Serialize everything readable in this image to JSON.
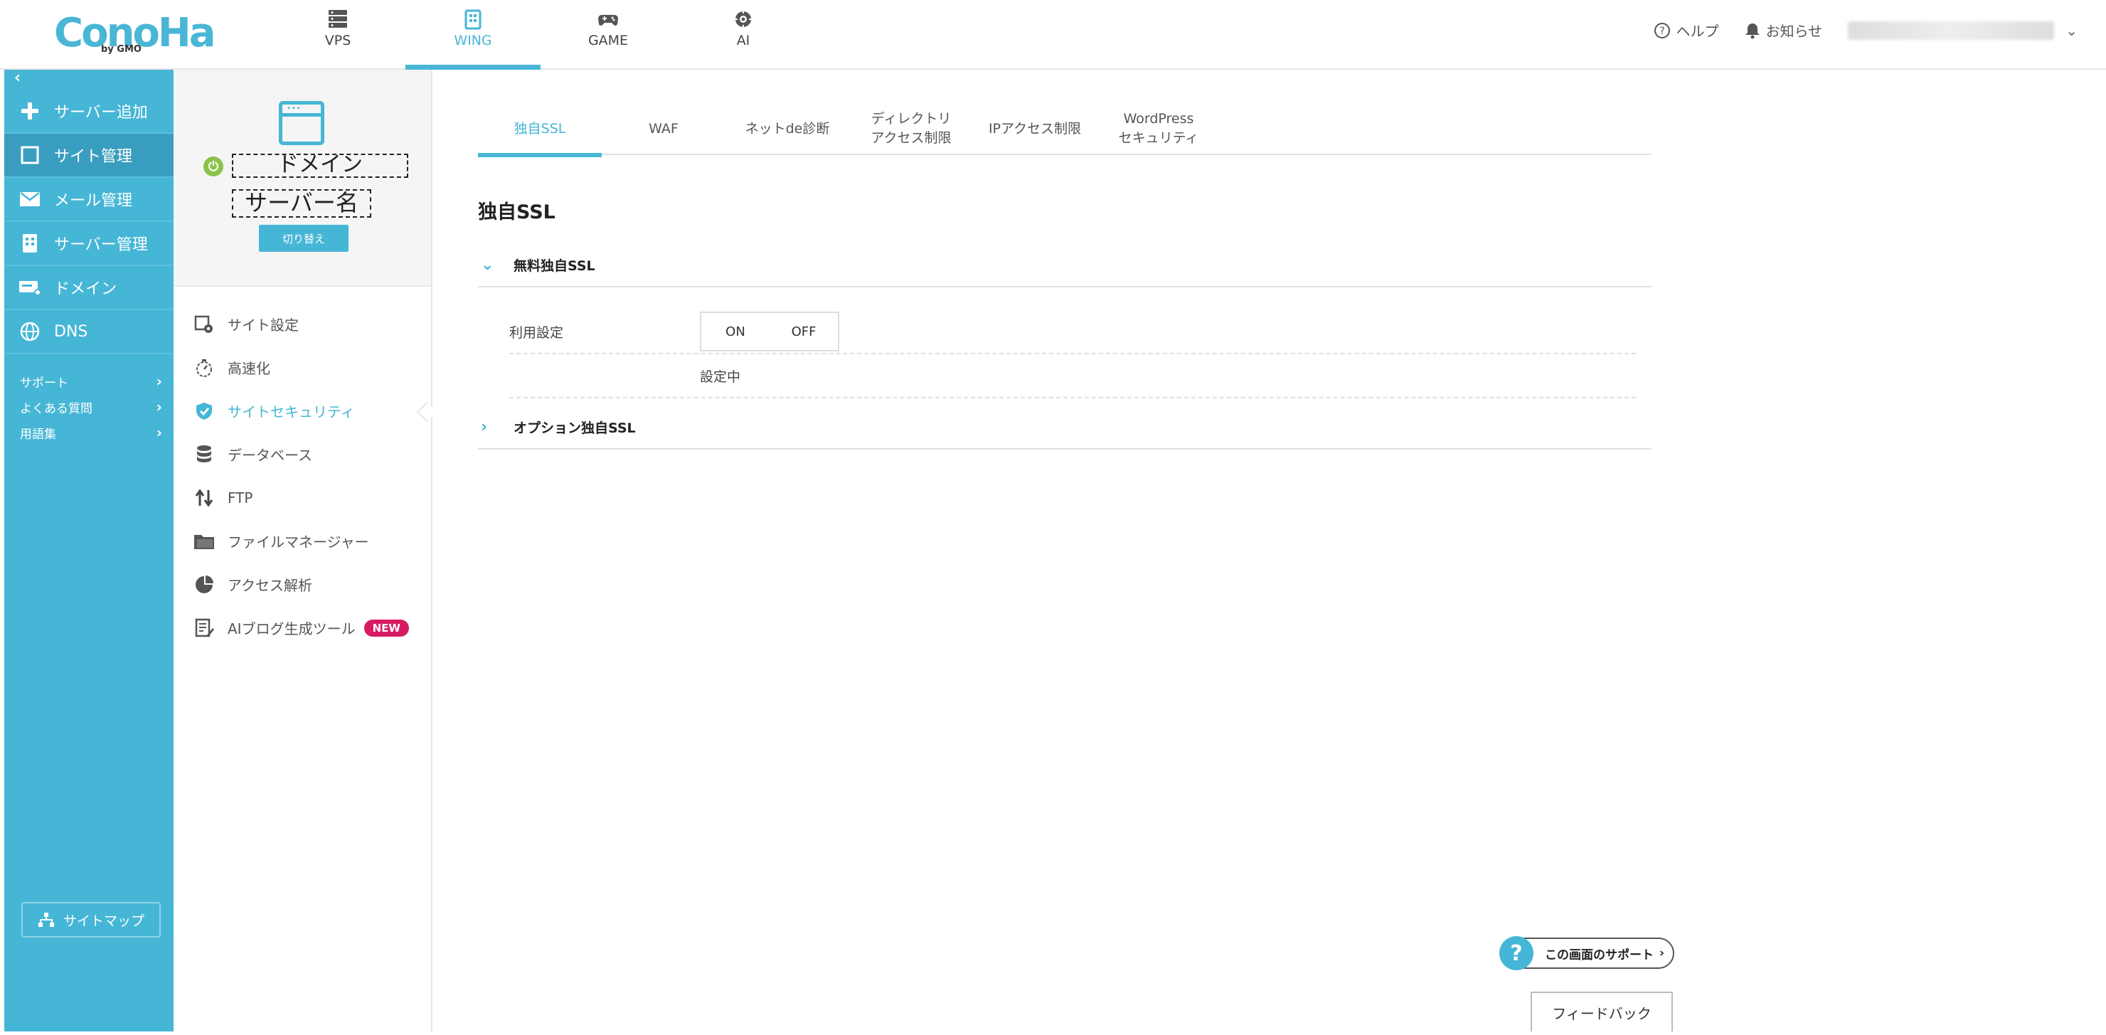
{
  "brand": {
    "logo_text": "ConoHa",
    "logo_sub": "by GMO",
    "accent_color": "#46b6d6"
  },
  "topnav": [
    {
      "id": "vps",
      "label": "VPS",
      "icon": "server-stack-icon"
    },
    {
      "id": "wing",
      "label": "WING",
      "icon": "building-icon",
      "active": true
    },
    {
      "id": "game",
      "label": "GAME",
      "icon": "gamepad-icon"
    },
    {
      "id": "ai",
      "label": "AI",
      "icon": "ai-chip-icon"
    }
  ],
  "topright": {
    "help": "ヘルプ",
    "notices": "お知らせ"
  },
  "sidebar": {
    "items": [
      {
        "label": "サーバー追加",
        "icon": "plus-icon"
      },
      {
        "label": "サイト管理",
        "icon": "window-icon",
        "active": true
      },
      {
        "label": "メール管理",
        "icon": "envelope-icon"
      },
      {
        "label": "サーバー管理",
        "icon": "server-icon"
      },
      {
        "label": "ドメイン",
        "icon": "domain-card-icon"
      },
      {
        "label": "DNS",
        "icon": "globe-icon"
      }
    ],
    "links": [
      {
        "label": "サポート"
      },
      {
        "label": "よくある質問"
      },
      {
        "label": "用語集"
      }
    ],
    "sitemap": "サイトマップ"
  },
  "subpanel": {
    "domain": "ドメイン",
    "server": "サーバー名",
    "switch_label": "切り替え",
    "menu": [
      {
        "label": "サイト設定",
        "icon": "site-settings-icon"
      },
      {
        "label": "高速化",
        "icon": "stopwatch-icon"
      },
      {
        "label": "サイトセキュリティ",
        "icon": "shield-check-icon",
        "active": true
      },
      {
        "label": "データベース",
        "icon": "database-icon"
      },
      {
        "label": "FTP",
        "icon": "transfer-arrows-icon"
      },
      {
        "label": "ファイルマネージャー",
        "icon": "folder-icon"
      },
      {
        "label": "アクセス解析",
        "icon": "pie-chart-icon"
      },
      {
        "label": "AIブログ生成ツール",
        "icon": "document-edit-icon",
        "badge": "NEW"
      }
    ]
  },
  "tabs": [
    {
      "label1": "独自SSL",
      "label2": "",
      "active": true
    },
    {
      "label1": "WAF",
      "label2": ""
    },
    {
      "label1": "ネットde診断",
      "label2": ""
    },
    {
      "label1": "ディレクトリ",
      "label2": "アクセス制限"
    },
    {
      "label1": "IPアクセス制限",
      "label2": ""
    },
    {
      "label1": "WordPress",
      "label2": "セキュリティ"
    }
  ],
  "section": {
    "title": "独自SSL",
    "free_ssl": "無料独自SSL",
    "setting_label": "利用設定",
    "toggle_on": "ON",
    "toggle_off": "OFF",
    "status": "設定中",
    "option_ssl": "オプション独自SSL"
  },
  "support_button": "この画面のサポート",
  "feedback_button": "フィードバック"
}
